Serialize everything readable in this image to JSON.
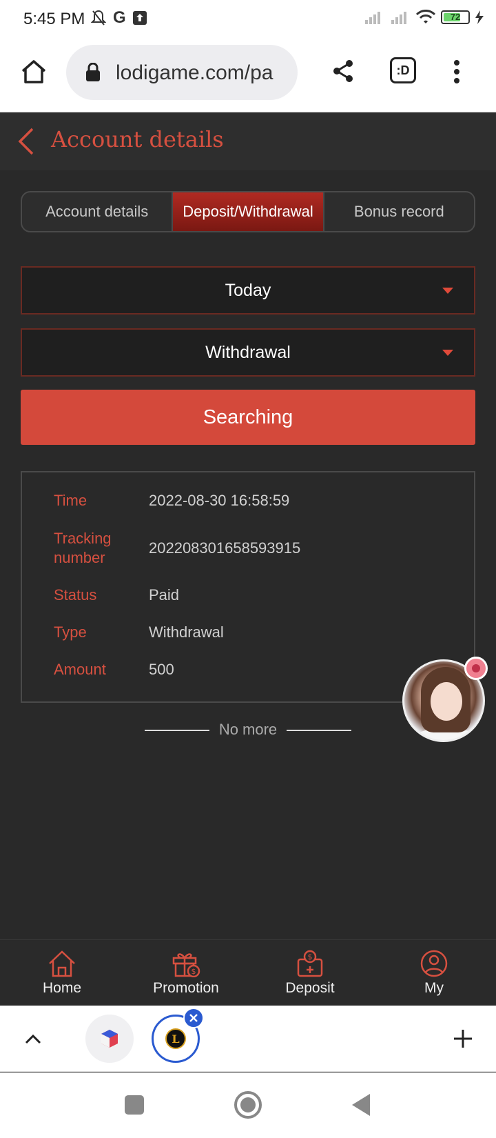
{
  "status_bar": {
    "time": "5:45 PM",
    "google_letter": "G",
    "battery": "72",
    "battery_level": 0.72
  },
  "browser": {
    "url": "lodigame.com/pa",
    "tab_switch_label": ":D"
  },
  "header": {
    "title": "Account details"
  },
  "tabs": [
    {
      "label": "Account details",
      "active": false
    },
    {
      "label": "Deposit/Withdrawal",
      "active": true
    },
    {
      "label": "Bonus record",
      "active": false
    }
  ],
  "filters": {
    "date_value": "Today",
    "type_value": "Withdrawal"
  },
  "search_button": "Searching",
  "record": {
    "rows": [
      {
        "label": "Time",
        "value": "2022-08-30 16:58:59"
      },
      {
        "label": "Tracking number",
        "value": "202208301658593915"
      },
      {
        "label": "Status",
        "value": "Paid"
      },
      {
        "label": "Type",
        "value": "Withdrawal"
      },
      {
        "label": "Amount",
        "value": "500"
      }
    ]
  },
  "no_more": "No more",
  "bottom_nav": [
    {
      "label": "Home",
      "icon": "home-icon"
    },
    {
      "label": "Promotion",
      "icon": "gift-icon"
    },
    {
      "label": "Deposit",
      "icon": "deposit-icon"
    },
    {
      "label": "My",
      "icon": "user-icon"
    }
  ],
  "tab_strip": {
    "active_tab_letter": "L"
  },
  "colors": {
    "accent": "#d4493b",
    "tab_active": "#9a2018",
    "background": "#292929"
  }
}
